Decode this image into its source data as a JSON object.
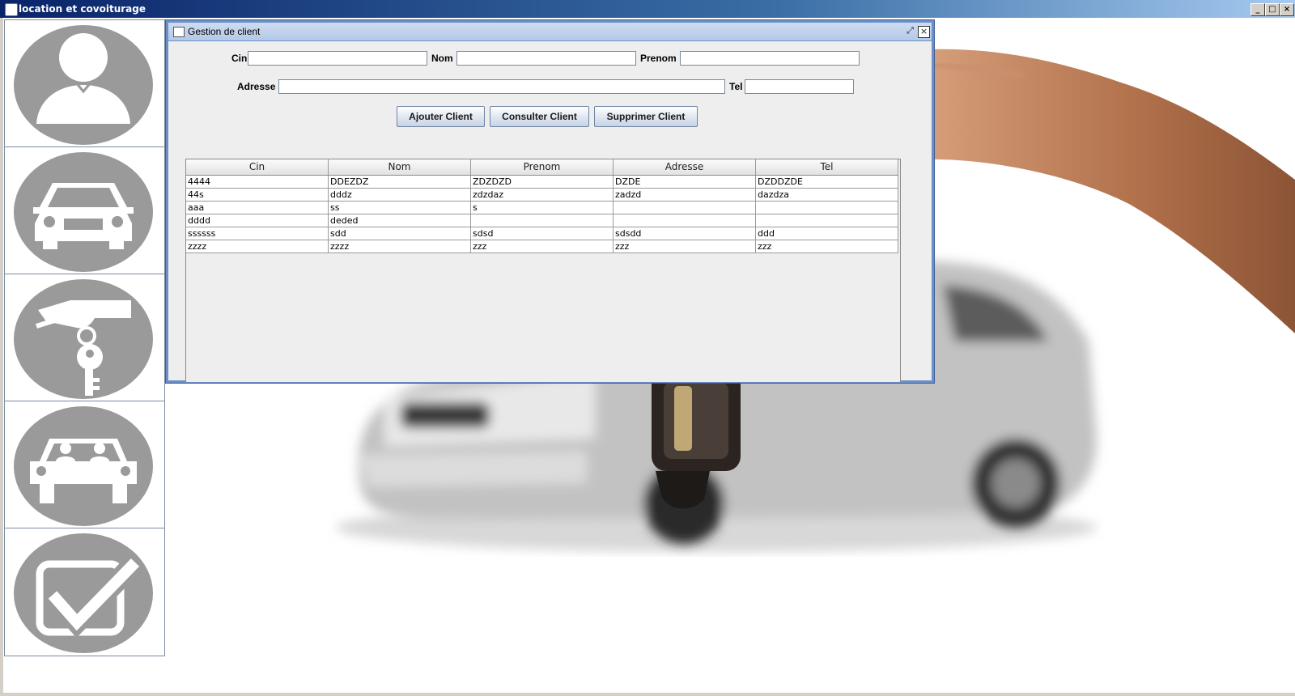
{
  "window": {
    "title": "location et covoiturage",
    "minimize_icon": "minimize-icon",
    "maximize_icon": "maximize-icon",
    "close_icon": "close-icon"
  },
  "sidebar": {
    "items": [
      {
        "icon": "user-icon"
      },
      {
        "icon": "car-icon"
      },
      {
        "icon": "key-icon"
      },
      {
        "icon": "carpool-icon"
      },
      {
        "icon": "checkbox-icon"
      }
    ]
  },
  "internal_frame": {
    "title": "Gestion de client",
    "form": {
      "cin_label": "Cin",
      "cin_value": "",
      "nom_label": "Nom",
      "nom_value": "",
      "prenom_label": "Prenom",
      "prenom_value": "",
      "adresse_label": "Adresse",
      "adresse_value": "",
      "tel_label": "Tel",
      "tel_value": ""
    },
    "buttons": {
      "add": "Ajouter Client",
      "consult": "Consulter Client",
      "delete": "Supprimer Client"
    },
    "table": {
      "columns": [
        "Cin",
        "Nom",
        "Prenom",
        "Adresse",
        "Tel"
      ],
      "rows": [
        [
          "4444",
          "DDEZDZ",
          "ZDZDZD",
          "DZDE",
          "DZDDZDE"
        ],
        [
          "44s",
          "dddz",
          "zdzdaz",
          "zadzd",
          "dazdza"
        ],
        [
          "aaa",
          "ss",
          "s",
          "",
          ""
        ],
        [
          "dddd",
          "deded",
          "",
          "",
          ""
        ],
        [
          "ssssss",
          "sdd",
          "sdsd",
          "sdsdd",
          "ddd"
        ],
        [
          "zzzz",
          "zzzz",
          "zzz",
          "zzz",
          "zzz"
        ]
      ]
    }
  }
}
